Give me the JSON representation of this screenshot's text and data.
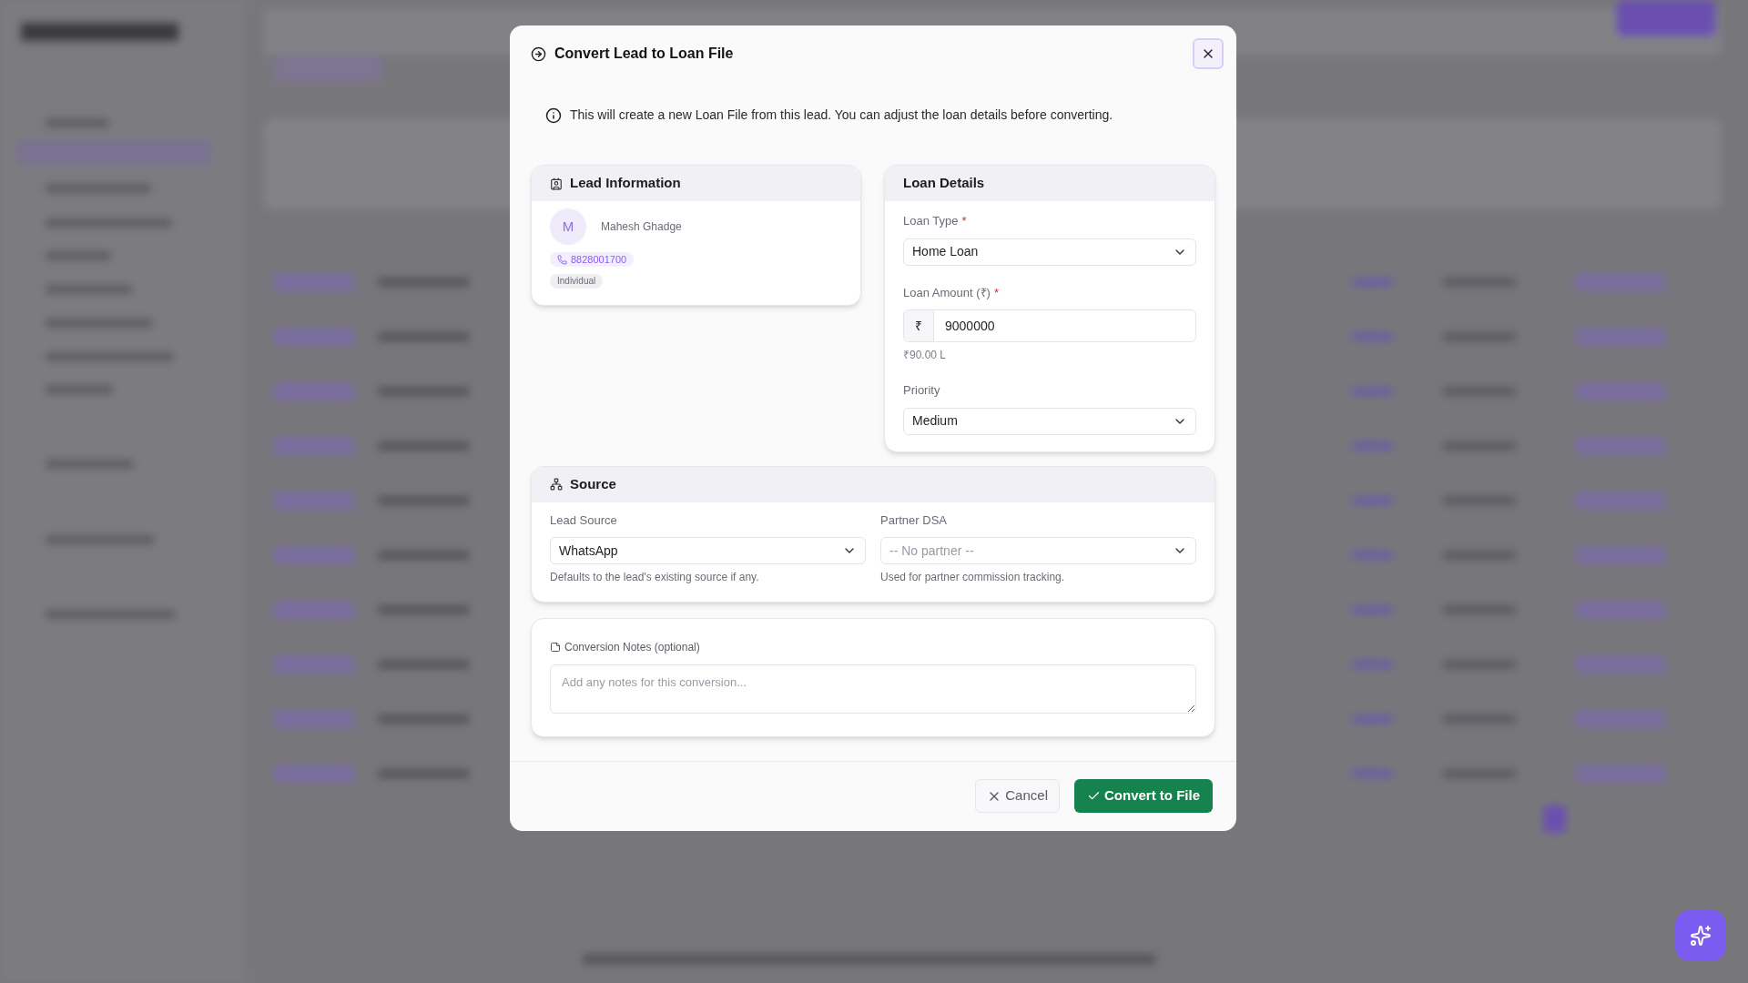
{
  "dialog": {
    "title": "Convert Lead to Loan File",
    "info": "This will create a new Loan File from this lead. You can adjust the loan details before converting.",
    "lead_card": {
      "title": "Lead Information",
      "avatar_initial": "M",
      "name": "Mahesh Ghadge",
      "phone": "8828001700",
      "type_badge": "Individual"
    },
    "loan_card": {
      "title": "Loan Details",
      "fields": [
        {
          "kind": "select",
          "label": "Loan Type",
          "required_mark": "*",
          "value": "Home Loan"
        },
        {
          "kind": "amount",
          "label": "Loan Amount (₹)",
          "required_mark": "*",
          "prefix": "₹",
          "value": "9000000",
          "hint": "₹90.00 L"
        },
        {
          "kind": "select",
          "label": "Priority",
          "value": "Medium"
        }
      ]
    },
    "source_card": {
      "title": "Source",
      "fields": [
        {
          "label": "Lead Source",
          "value": "WhatsApp",
          "hint": "Defaults to the lead's existing source if any."
        },
        {
          "label": "Partner DSA",
          "placeholder": "-- No partner --",
          "hint": "Used for partner commission tracking."
        }
      ]
    },
    "notes": {
      "label": "Conversion Notes (optional)",
      "placeholder": "Add any notes for this conversion..."
    },
    "buttons": [
      {
        "kind": "secondary",
        "label": "Cancel"
      },
      {
        "kind": "primary",
        "label": "Convert to File"
      }
    ]
  }
}
